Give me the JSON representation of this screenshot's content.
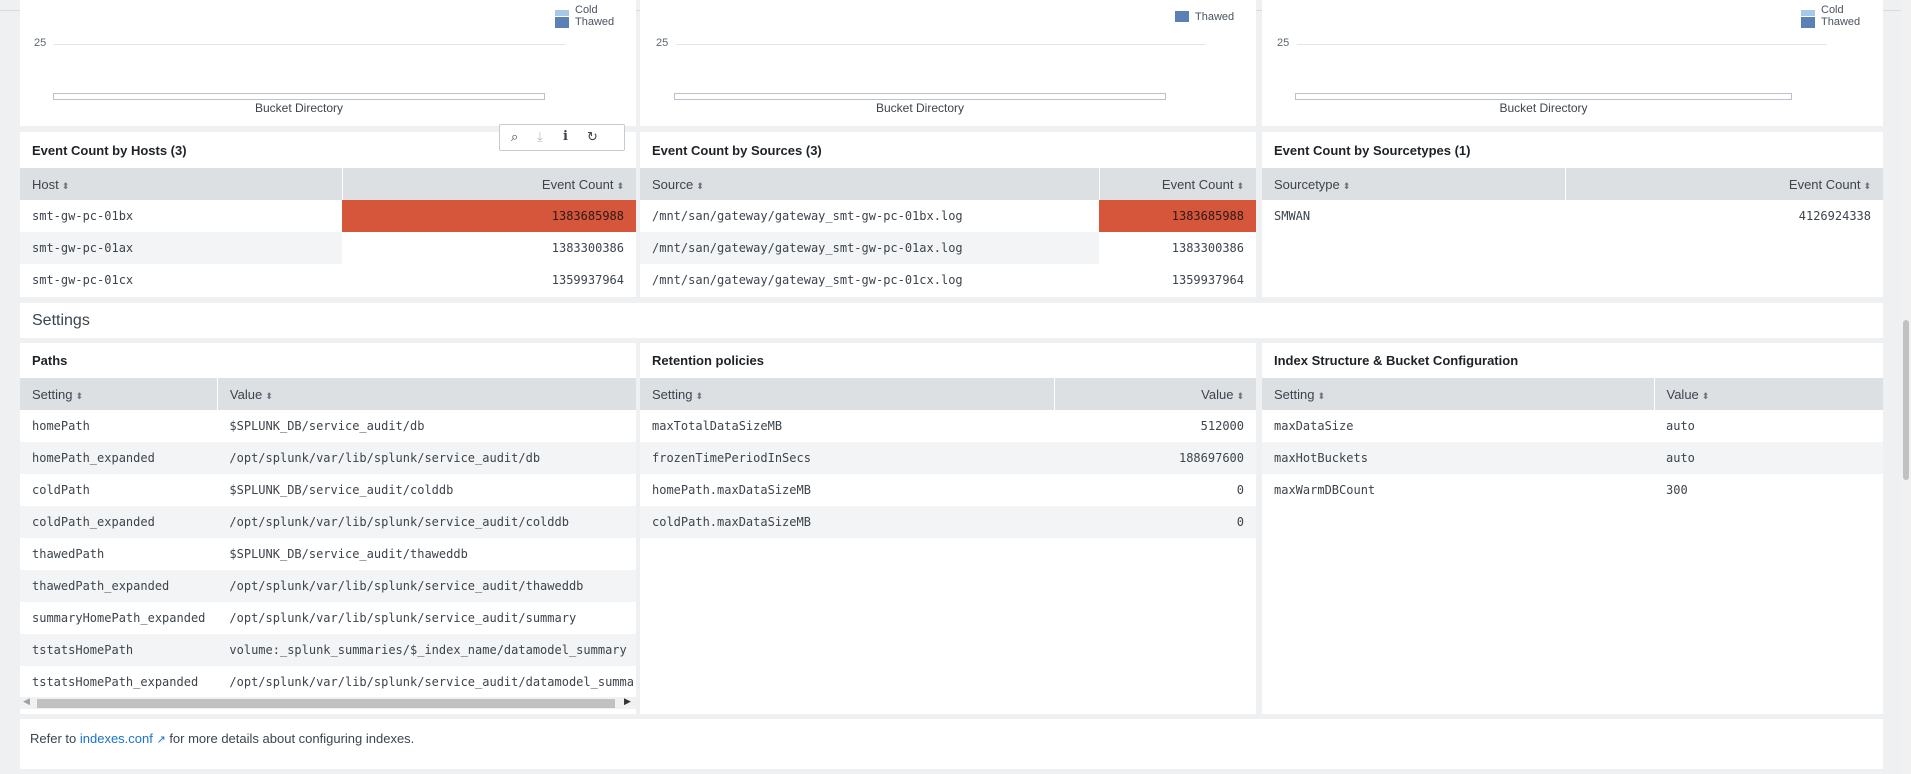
{
  "charts": [
    {
      "tick": "25",
      "xlabel": "Bucket Directory",
      "legend": [
        "Cold",
        "Thawed"
      ]
    },
    {
      "tick": "25",
      "xlabel": "Bucket Directory",
      "legend": [
        "Thawed"
      ]
    },
    {
      "tick": "25",
      "xlabel": "Bucket Directory",
      "legend": [
        "Cold",
        "Thawed"
      ]
    }
  ],
  "colors": {
    "cold": "#a8c8e8",
    "thawed": "#5a80b6",
    "hot_cell": "#d6563c",
    "link": "#1a73c8"
  },
  "toolbar": {
    "icons": [
      "search-icon",
      "download-icon",
      "info-icon",
      "refresh-icon"
    ]
  },
  "hosts": {
    "title": "Event Count by Hosts (3)",
    "columns": [
      "Host",
      "Event Count"
    ],
    "rows": [
      [
        "smt-gw-pc-01bx",
        "1383685988"
      ],
      [
        "smt-gw-pc-01ax",
        "1383300386"
      ],
      [
        "smt-gw-pc-01cx",
        "1359937964"
      ]
    ]
  },
  "sources": {
    "title": "Event Count by Sources (3)",
    "columns": [
      "Source",
      "Event Count"
    ],
    "rows": [
      [
        "/mnt/san/gateway/gateway_smt-gw-pc-01bx.log",
        "1383685988"
      ],
      [
        "/mnt/san/gateway/gateway_smt-gw-pc-01ax.log",
        "1383300386"
      ],
      [
        "/mnt/san/gateway/gateway_smt-gw-pc-01cx.log",
        "1359937964"
      ]
    ]
  },
  "sourcetypes": {
    "title": "Event Count by Sourcetypes (1)",
    "columns": [
      "Sourcetype",
      "Event Count"
    ],
    "rows": [
      [
        "SMWAN",
        "4126924338"
      ]
    ]
  },
  "settings_title": "Settings",
  "paths": {
    "title": "Paths",
    "columns": [
      "Setting",
      "Value"
    ],
    "rows": [
      [
        "homePath",
        "$SPLUNK_DB/service_audit/db"
      ],
      [
        "homePath_expanded",
        "/opt/splunk/var/lib/splunk/service_audit/db"
      ],
      [
        "coldPath",
        "$SPLUNK_DB/service_audit/colddb"
      ],
      [
        "coldPath_expanded",
        "/opt/splunk/var/lib/splunk/service_audit/colddb"
      ],
      [
        "thawedPath",
        "$SPLUNK_DB/service_audit/thaweddb"
      ],
      [
        "thawedPath_expanded",
        "/opt/splunk/var/lib/splunk/service_audit/thaweddb"
      ],
      [
        "summaryHomePath_expanded",
        "/opt/splunk/var/lib/splunk/service_audit/summary"
      ],
      [
        "tstatsHomePath",
        "volume:_splunk_summaries/$_index_name/datamodel_summary"
      ],
      [
        "tstatsHomePath_expanded",
        "/opt/splunk/var/lib/splunk/service_audit/datamodel_summary"
      ]
    ]
  },
  "retention": {
    "title": "Retention policies",
    "columns": [
      "Setting",
      "Value"
    ],
    "rows": [
      [
        "maxTotalDataSizeMB",
        "512000"
      ],
      [
        "frozenTimePeriodInSecs",
        "188697600"
      ],
      [
        "homePath.maxDataSizeMB",
        "0"
      ],
      [
        "coldPath.maxDataSizeMB",
        "0"
      ]
    ]
  },
  "structure": {
    "title": "Index Structure & Bucket Configuration",
    "columns": [
      "Setting",
      "Value"
    ],
    "rows": [
      [
        "maxDataSize",
        "auto"
      ],
      [
        "maxHotBuckets",
        "auto"
      ],
      [
        "maxWarmDBCount",
        "300"
      ]
    ]
  },
  "footer": {
    "prefix": "Refer to ",
    "link": "indexes.conf",
    "suffix": " for more details about configuring indexes."
  }
}
